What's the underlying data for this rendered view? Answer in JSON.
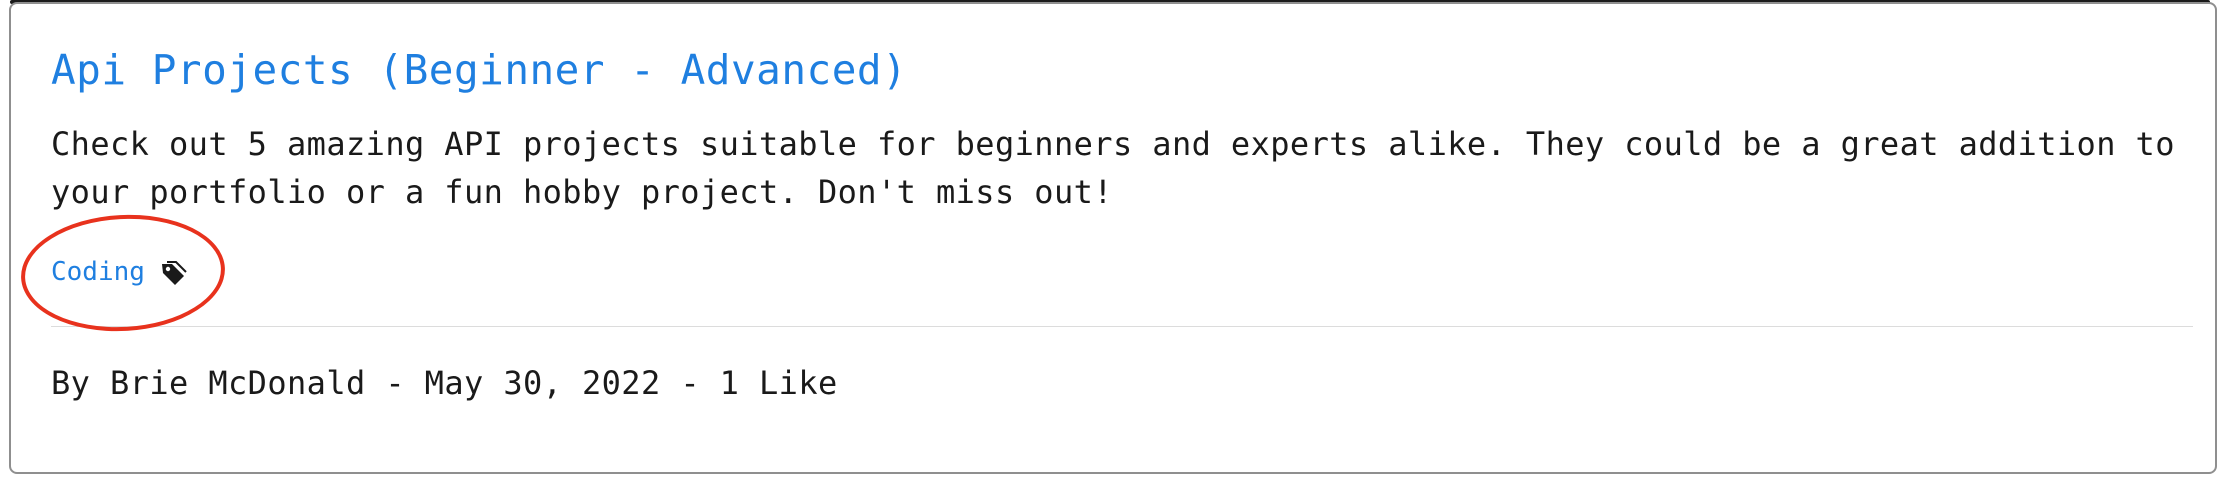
{
  "post": {
    "title": "Api Projects (Beginner - Advanced)",
    "description": "Check out 5 amazing API projects suitable for beginners and experts alike. They could be a great addition to your portfolio or a fun hobby project. Don't miss out!",
    "tag": {
      "label": "Coding",
      "icon": "tag-icon"
    },
    "meta": {
      "by_prefix": "By ",
      "author": "Brie McDonald",
      "separator": " - ",
      "date": "May 30, 2022",
      "likes": "1 Like"
    }
  },
  "colors": {
    "link": "#1f7fe0",
    "text": "#1a1a1a",
    "highlight": "#e8321d",
    "border": "#8f8f8f"
  }
}
